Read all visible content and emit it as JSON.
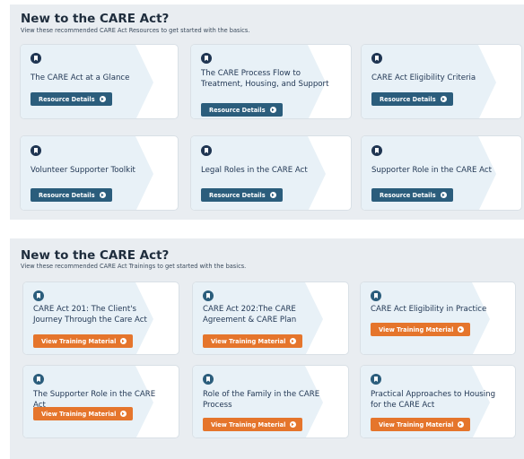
{
  "resources": {
    "title": "New to the CARE Act?",
    "subtitle": "View these recommended CARE Act Resources to get started with the basics.",
    "button_label": "Resource Details",
    "button_color": "#2b5d7c",
    "icon": "bookmark-icon",
    "cards": [
      {
        "title": "The CARE Act at a Glance"
      },
      {
        "title": "The CARE Process Flow to Treatment, Housing, and Support"
      },
      {
        "title": "CARE Act Eligibility Criteria"
      },
      {
        "title": "Volunteer Supporter Toolkit"
      },
      {
        "title": "Legal Roles in the CARE Act"
      },
      {
        "title": "Supporter Role in the CARE Act"
      }
    ]
  },
  "trainings": {
    "title": "New to the CARE Act?",
    "subtitle": "View these recommended CARE Act Trainings to get started with the basics.",
    "button_label": "View Training Material",
    "button_color": "#e5752c",
    "icon": "bookmark-icon",
    "cards": [
      {
        "title": "CARE Act 201: The Client's Journey Through the Care Act"
      },
      {
        "title": "CARE Act 202:The CARE Agreement & CARE Plan"
      },
      {
        "title": "CARE Act Eligibility in Practice"
      },
      {
        "title": "The Supporter Role in the CARE Act"
      },
      {
        "title": "Role of the Family in the CARE Process"
      },
      {
        "title": "Practical Approaches to Housing for the CARE Act"
      }
    ]
  }
}
